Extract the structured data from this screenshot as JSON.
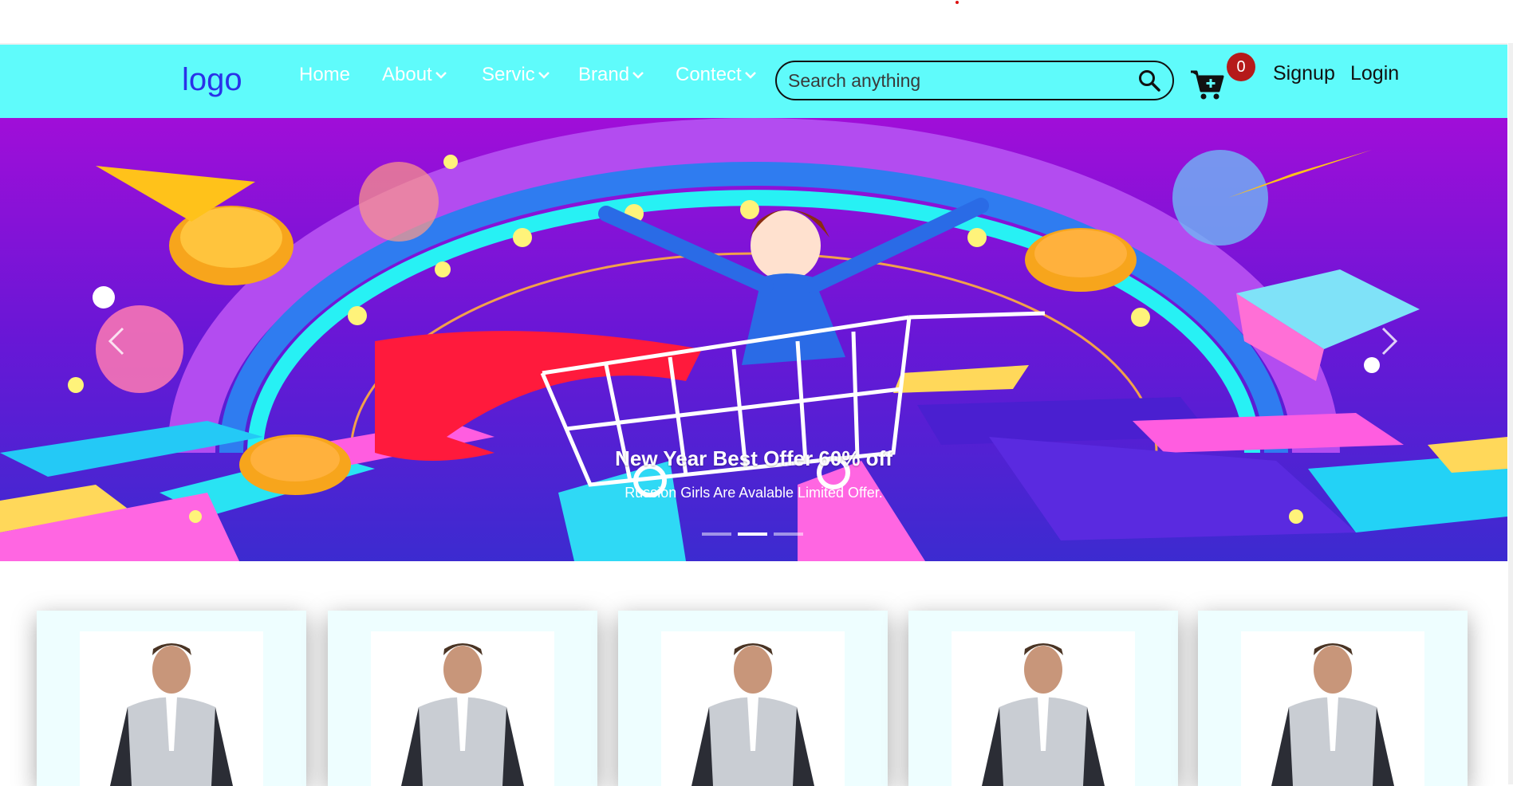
{
  "nav": {
    "logo": "logo",
    "items": [
      {
        "label": "Home",
        "has_dropdown": false
      },
      {
        "label": "About",
        "has_dropdown": true
      },
      {
        "label": "Servic",
        "has_dropdown": true
      },
      {
        "label": "Brand",
        "has_dropdown": true
      },
      {
        "label": "Contect",
        "has_dropdown": true
      }
    ],
    "search_placeholder": "Search anything",
    "cart_count": "0",
    "signup": "Signup",
    "login": "Login"
  },
  "carousel": {
    "title": "New Year Best Offer 60% off",
    "subtitle": "Russion Girls Are Avalable Limited Offer.",
    "slide_count": 3,
    "active_index": 1
  },
  "products": {
    "card_count": 5
  },
  "colors": {
    "navbar_bg": "#5ffbfb",
    "logo": "#2a32e8",
    "badge": "#b51a1a",
    "card_bg": "#eefeff"
  }
}
